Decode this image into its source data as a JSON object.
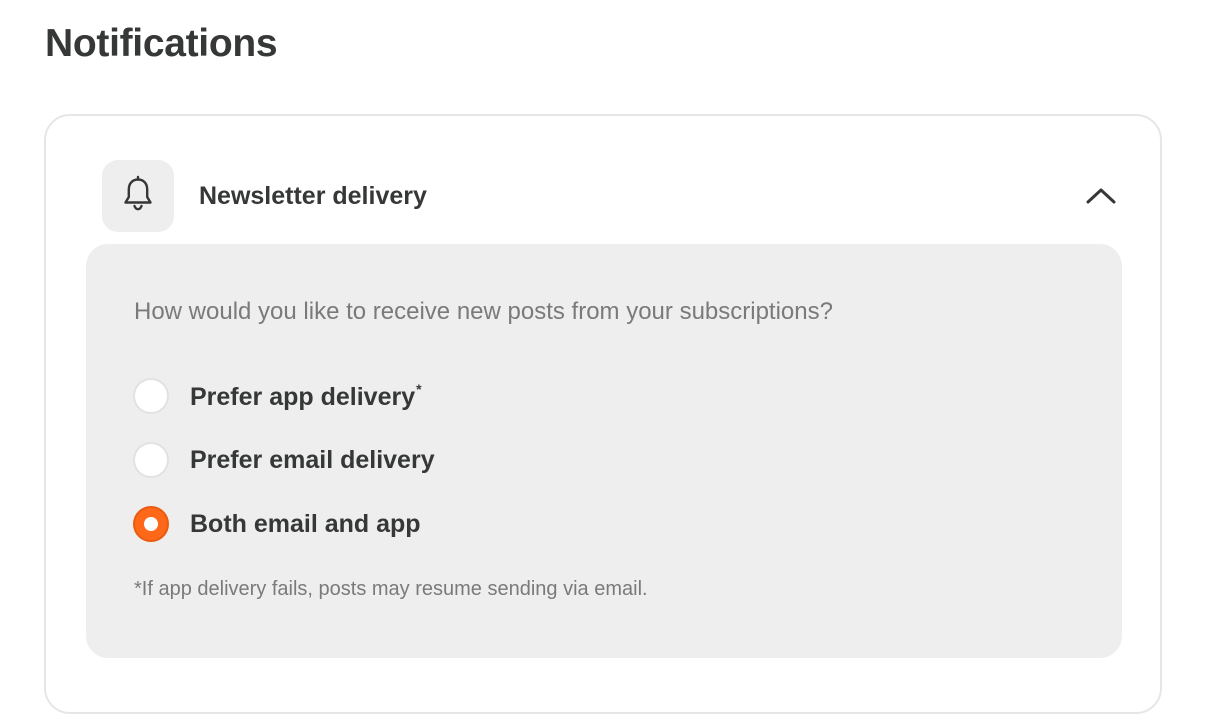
{
  "page": {
    "title": "Notifications"
  },
  "newsletter_section": {
    "icon": "bell-icon",
    "title": "Newsletter delivery",
    "expanded": true,
    "toggle_icon": "chevron-up-icon",
    "question": "How would you like to receive new posts from your subscriptions?",
    "options": [
      {
        "label": "Prefer app delivery",
        "marker": "*",
        "selected": false
      },
      {
        "label": "Prefer email delivery",
        "marker": "",
        "selected": false
      },
      {
        "label": "Both email and app",
        "marker": "",
        "selected": true
      }
    ],
    "footnote": "*If app delivery fails, posts may resume sending via email."
  },
  "colors": {
    "accent": "#ff6719",
    "text_primary": "#363737",
    "text_secondary": "#7a7a7a",
    "panel_background": "#eeeeee",
    "card_border": "#e6e6e6"
  }
}
